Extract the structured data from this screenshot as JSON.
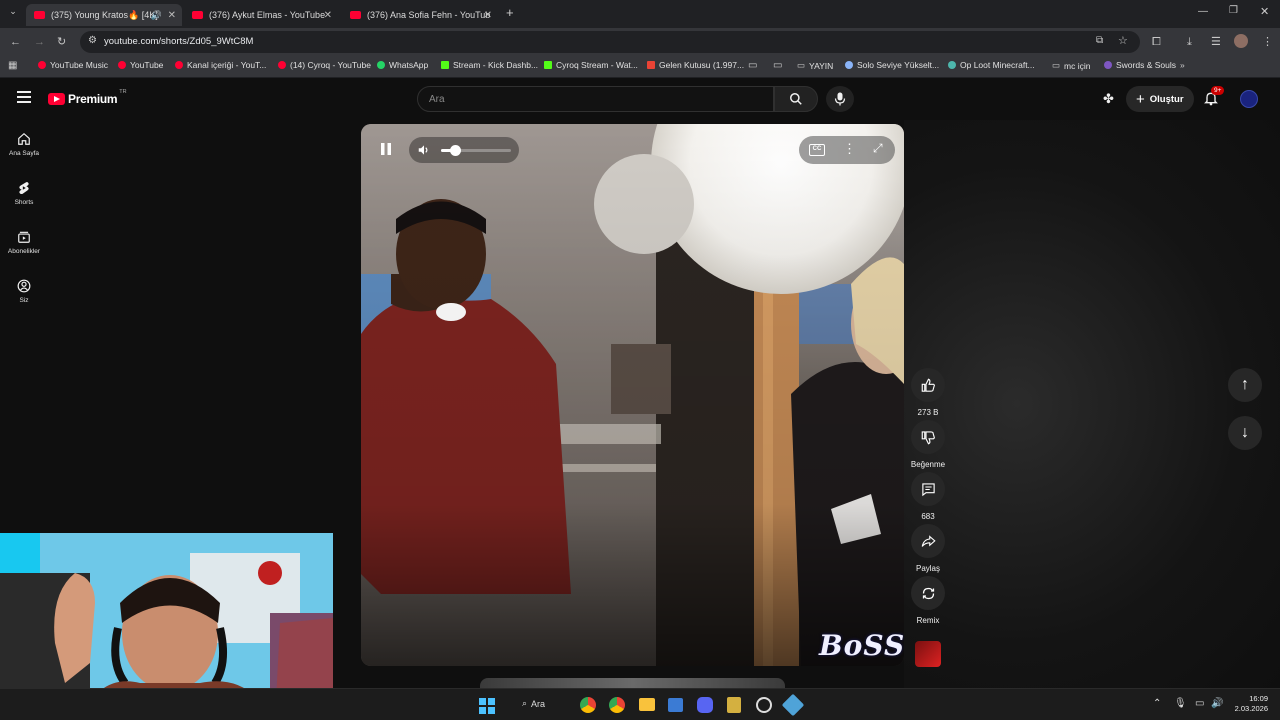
{
  "browser": {
    "tabs": [
      {
        "title": "(375) Young Kratos🔥 [4K]",
        "active": true
      },
      {
        "title": "(376) Aykut Elmas - YouTube",
        "active": false
      },
      {
        "title": "(376) Ana Sofia Fehn - YouTube",
        "active": false
      }
    ],
    "url": "youtube.com/shorts/Zd05_9WtC8M",
    "bookmarks": [
      {
        "label": "YouTube Music",
        "color": "#ff0033"
      },
      {
        "label": "YouTube",
        "color": "#ff0033"
      },
      {
        "label": "Kanal içeriği - YouT...",
        "color": "#ff0033"
      },
      {
        "label": "(14) Cyroq - YouTube",
        "color": "#ff0033"
      },
      {
        "label": "WhatsApp",
        "color": "#25d366"
      },
      {
        "label": "Stream - Kick Dashb...",
        "color": "#53fc18"
      },
      {
        "label": "Cyroq Stream - Wat...",
        "color": "#53fc18"
      },
      {
        "label": "Gelen Kutusu (1.997...",
        "color": "#ea4335"
      },
      {
        "label": "",
        "color": "#cccccc"
      },
      {
        "label": "",
        "color": "#cccccc"
      },
      {
        "label": "YAYIN",
        "color": "#cccccc"
      },
      {
        "label": "Solo Seviye Yükselt...",
        "color": "#8ab4f8"
      },
      {
        "label": "Op Loot Minecraft...",
        "color": "#4db6ac"
      },
      {
        "label": "mc için",
        "color": "#cccccc"
      },
      {
        "label": "Swords & Souls",
        "color": "#7e57c2"
      }
    ]
  },
  "youtube": {
    "logo": "Premium",
    "region": "TR",
    "search_placeholder": "Ara",
    "create_label": "Oluştur",
    "notification_badge": "9+",
    "nav": [
      {
        "label": "Ana Sayfa",
        "icon": "home-icon"
      },
      {
        "label": "Shorts",
        "icon": "shorts-icon"
      },
      {
        "label": "Abonelikler",
        "icon": "subscriptions-icon"
      },
      {
        "label": "Siz",
        "icon": "profile-icon"
      }
    ],
    "actions": {
      "likes": "273 B",
      "dislike_label": "Beğenme",
      "comments": "683",
      "share_label": "Paylaş",
      "remix_label": "Remix"
    },
    "video": {
      "volume_fraction": 0.2,
      "watermark": "BoSS"
    }
  },
  "taskbar": {
    "search_label": "Ara",
    "time": "16:09",
    "date": "2.03.2026"
  },
  "colors": {
    "youtube_red": "#ff0033",
    "background": "#0f0f0f",
    "notification": "#cc0000"
  }
}
